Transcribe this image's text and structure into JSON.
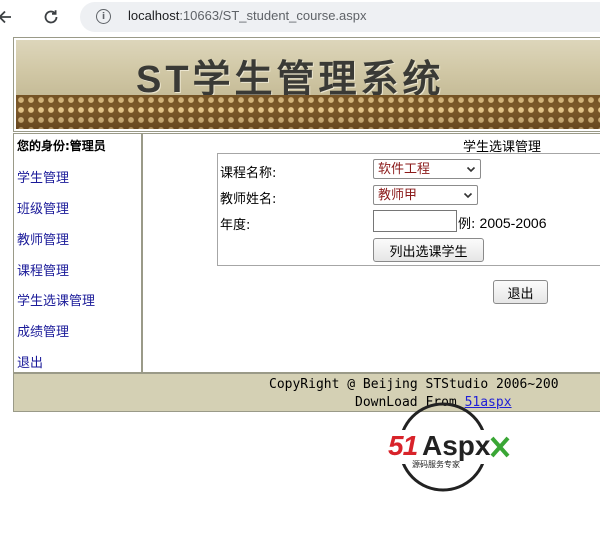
{
  "browser": {
    "url_host": "localhost",
    "url_rest": ":10663/ST_student_course.aspx"
  },
  "banner": {
    "title": "ST学生管理系统"
  },
  "sidebar": {
    "identity": "您的身份:管理员",
    "items": [
      {
        "label": "学生管理"
      },
      {
        "label": "班级管理"
      },
      {
        "label": "教师管理"
      },
      {
        "label": "课程管理"
      },
      {
        "label": "学生选课管理"
      },
      {
        "label": "成绩管理"
      },
      {
        "label": "退出"
      }
    ]
  },
  "main": {
    "page_title": "学生选课管理",
    "form": {
      "course_label": "课程名称:",
      "course_value": "软件工程",
      "teacher_label": "教师姓名:",
      "teacher_value": "教师甲",
      "year_label": "年度:",
      "year_value": "",
      "year_hint_prefix": "例:",
      "year_hint_value": "2005-2006",
      "list_button": "列出选课学生"
    },
    "exit_button": "退出"
  },
  "footer": {
    "copyright": "CopyRight @ Beijing STStudio 2006~200",
    "download_prefix": "DownLoad From",
    "download_link": "51aspx"
  },
  "watermark": {
    "brand": "51Aspx",
    "tagline": "源码服务专家"
  },
  "colors": {
    "link": "#1a1a99",
    "select_text": "#8b1a1a",
    "footer_bg": "#d4d0b4",
    "banner_bg": "#d1c8a6"
  }
}
